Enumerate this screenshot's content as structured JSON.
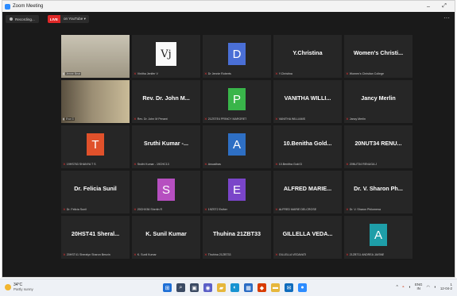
{
  "window": {
    "title": "Zoom Meeting",
    "controls": {
      "minimize": "–",
      "maximize": "⤢"
    }
  },
  "status": {
    "recording_label": "Recording...",
    "live_label": "LIVE",
    "live_target": "on YouTube ▾",
    "more": "···"
  },
  "colors": {
    "active_speaker_border": "#c8e23c",
    "live_red": "#e02828",
    "tile_bg": "#262626",
    "mute_icon": "#e33333"
  },
  "tiles": [
    {
      "kind": "photo",
      "photo": 1,
      "label": "Jenne Beat",
      "muted": false,
      "active": true
    },
    {
      "kind": "logo",
      "logo_text": "Vj",
      "label": "Vinitha Jenifer V",
      "muted": true
    },
    {
      "kind": "avatar",
      "letter": "D",
      "color": "#4a6fd6",
      "label": "Dr Jennie Roberts",
      "muted": true
    },
    {
      "kind": "name",
      "name": "Y.Christina",
      "label": "Y.Christina",
      "muted": true
    },
    {
      "kind": "name",
      "name": "Women's Christi...",
      "label": "Women's Christian College",
      "muted": true
    },
    {
      "kind": "photo",
      "photo": 2,
      "label": "Eva G",
      "muted": false
    },
    {
      "kind": "name",
      "name": "Rev. Dr. John M...",
      "label": "Rev. Dr. John M Penant",
      "muted": true
    },
    {
      "kind": "avatar",
      "letter": "P",
      "color": "#39b54a",
      "label": "21ZSTE4 PRINCY MARGRET",
      "muted": true
    },
    {
      "kind": "name",
      "name": "VANITHA WILLI...",
      "label": "VANITHA WILLIAMS",
      "muted": true
    },
    {
      "kind": "name",
      "name": "Jancy Merlin",
      "label": "Jancy Merlin",
      "muted": true
    },
    {
      "kind": "avatar",
      "letter": "T",
      "color": "#e0512b",
      "label": "19HS763 SHANYA T S",
      "muted": true
    },
    {
      "kind": "name",
      "name": "Sruthi Kumar -...",
      "label": "Sruthi Kumar - 19CHC13",
      "muted": true
    },
    {
      "kind": "avatar",
      "letter": "A",
      "color": "#2e6fc4",
      "label": "Anuadhas",
      "muted": true
    },
    {
      "kind": "name",
      "name": "10.Benitha Gold...",
      "label": "10.Benitha Gold D",
      "muted": true
    },
    {
      "kind": "name",
      "name": "20NUT34 RENU...",
      "label": "20NUT34 RENUGA J",
      "muted": true
    },
    {
      "kind": "name",
      "name": "Dr. Felicia Sunil",
      "label": "Dr. Felicia Sunil",
      "muted": true
    },
    {
      "kind": "avatar",
      "letter": "S",
      "color": "#b64fc0",
      "label": "20CHX36 Sherlin R",
      "muted": true
    },
    {
      "kind": "avatar",
      "letter": "E",
      "color": "#7a45c9",
      "label": "19ZST2 Esther",
      "muted": true
    },
    {
      "kind": "name",
      "name": "ALFRED MARIE...",
      "label": "ALFRED MARIE DELCROSE",
      "muted": true
    },
    {
      "kind": "name",
      "name": "Dr. V. Sharon Ph...",
      "label": "Dr. V. Sharon Philomena",
      "muted": true
    },
    {
      "kind": "name",
      "name": "20HST41 Sheral...",
      "label": "20HST41 Sheralyn Sharon Benzin",
      "muted": true
    },
    {
      "kind": "name",
      "name": "K. Sunil Kumar",
      "label": "K. Sunil Kumar",
      "muted": true
    },
    {
      "kind": "name",
      "name": "Thuhina 21ZBT33",
      "label": "Thuhina 21ZBT33",
      "muted": true
    },
    {
      "kind": "name",
      "name": "GILLELLA VEDA...",
      "label": "GILLELLA VEDAVATI",
      "muted": true
    },
    {
      "kind": "avatar",
      "letter": "A",
      "color": "#1e9ea8",
      "label": "21ZBT11 ANDREA JAISNE",
      "muted": true
    }
  ],
  "taskbar": {
    "weather": {
      "icon": "sun-icon",
      "temp": "34°C",
      "condition": "Partly sunny"
    },
    "apps": [
      {
        "icon": "windows-start-icon",
        "glyph": "⊞",
        "color": "#1f6fd6"
      },
      {
        "icon": "search-icon",
        "glyph": "⌕",
        "color": "#3b4a63"
      },
      {
        "icon": "task-view-icon",
        "glyph": "▣",
        "color": "#3b4a63"
      },
      {
        "icon": "chat-icon",
        "glyph": "◉",
        "color": "#5b5fc7"
      },
      {
        "icon": "file-explorer-icon",
        "glyph": "▰",
        "color": "#e6b73c"
      },
      {
        "icon": "edge-icon",
        "glyph": "◐",
        "color": "#1793d1"
      },
      {
        "icon": "store-icon",
        "glyph": "▦",
        "color": "#2b6cc4"
      },
      {
        "icon": "office-icon",
        "glyph": "◆",
        "color": "#d83b01"
      },
      {
        "icon": "notes-icon",
        "glyph": "▬",
        "color": "#e6b73c"
      },
      {
        "icon": "mail-icon",
        "glyph": "✉",
        "color": "#0f6cbd"
      },
      {
        "icon": "zoom-icon",
        "glyph": "●",
        "color": "#2d8cff"
      }
    ],
    "tray": {
      "chevron": "^",
      "language_top": "ENG",
      "language_bottom": "IN",
      "time": "1",
      "date": "12-04-2"
    }
  }
}
